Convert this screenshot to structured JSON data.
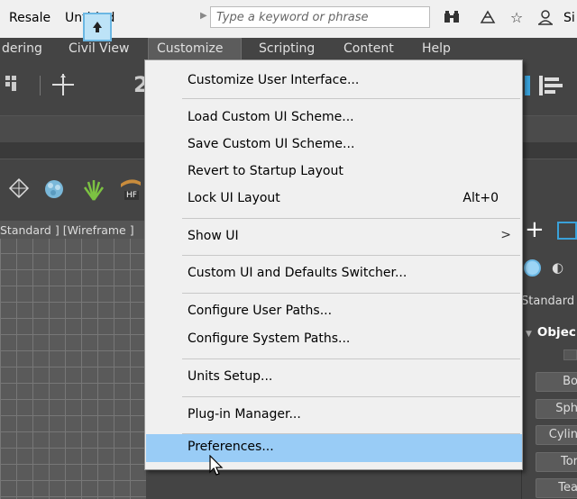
{
  "titlebar": {
    "app_name": "Resale",
    "document": "Untitled",
    "search_placeholder": "Type a keyword or phrase",
    "signin_partial": "Si"
  },
  "menubar": {
    "items": [
      {
        "label": "dering"
      },
      {
        "label": "Civil View"
      },
      {
        "label": "Customize"
      },
      {
        "label": "Scripting"
      },
      {
        "label": "Content"
      },
      {
        "label": "Help"
      }
    ]
  },
  "toolbar": {
    "number_partial": "2"
  },
  "ribbon": {
    "hf_label": "HF"
  },
  "viewport": {
    "label": "Standard ] [Wireframe ]"
  },
  "command_panel": {
    "standard_label": "Standard",
    "object_type_label": "Objec",
    "buttons": [
      "Bo",
      "Sph",
      "Cylin",
      "Tor",
      "Tea"
    ]
  },
  "dropdown": {
    "items": [
      {
        "label": "Customize User Interface...",
        "shortcut": ""
      },
      {
        "label": "Load Custom UI Scheme...",
        "shortcut": ""
      },
      {
        "label": "Save Custom UI Scheme...",
        "shortcut": ""
      },
      {
        "label": "Revert to Startup Layout",
        "shortcut": ""
      },
      {
        "label": "Lock UI Layout",
        "shortcut": "Alt+0"
      },
      {
        "label": "Show UI",
        "shortcut": "",
        "submenu_arrow": ">"
      },
      {
        "label": "Custom UI and Defaults Switcher...",
        "shortcut": ""
      },
      {
        "label": "Configure User Paths...",
        "shortcut": ""
      },
      {
        "label": "Configure System Paths...",
        "shortcut": ""
      },
      {
        "label": "Units Setup...",
        "shortcut": ""
      },
      {
        "label": "Plug-in Manager...",
        "shortcut": ""
      },
      {
        "label": "Preferences...",
        "shortcut": "",
        "highlighted": true
      }
    ]
  },
  "colors": {
    "menu_highlight": "#99ccf6",
    "accent_blue": "#3aa1d9"
  }
}
